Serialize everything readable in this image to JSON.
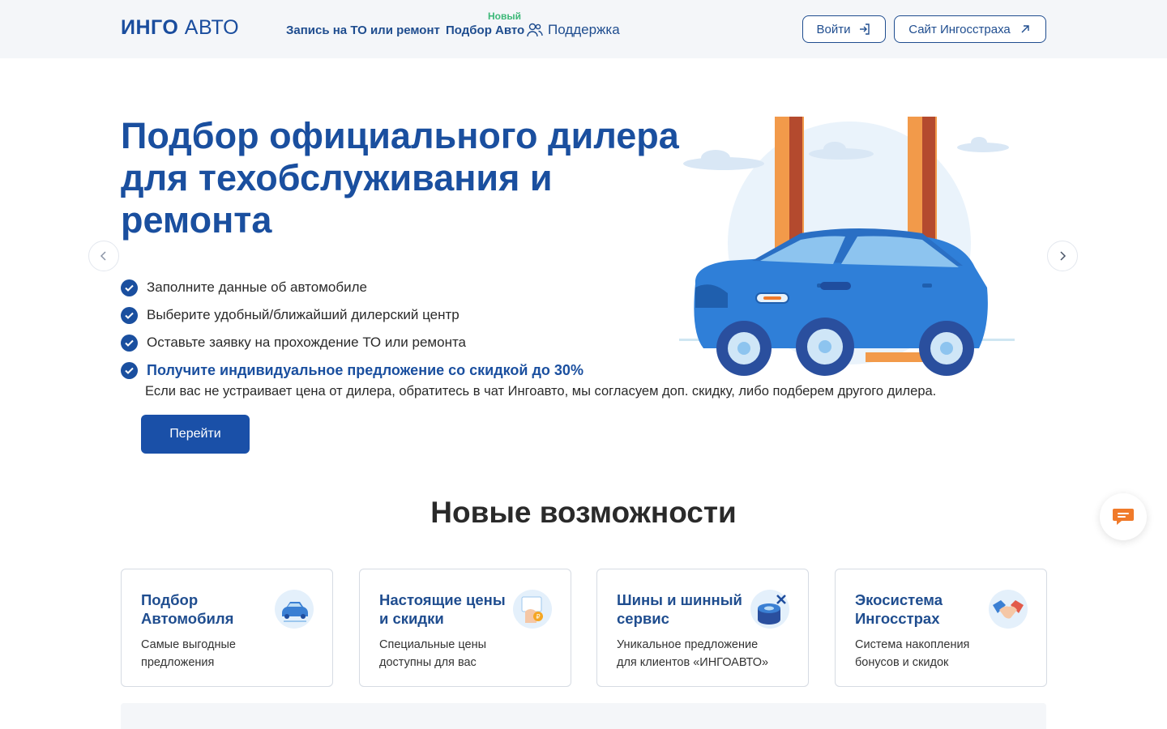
{
  "header": {
    "logo_bold": "ИНГО",
    "logo_light": "АВТО",
    "nav": [
      {
        "label": "Запись на ТО или ремонт"
      },
      {
        "label": "Подбор Авто",
        "badge": "Новый"
      },
      {
        "label": "Поддержка",
        "icon": "users-icon"
      }
    ],
    "login_label": "Войти",
    "site_label": "Сайт Ингосстраха"
  },
  "hero": {
    "title": "Подбор официального дилера для техобслуживания и ремонта",
    "features": [
      "Заполните данные об автомобиле",
      "Выберите удобный/ближайший дилерский центр",
      "Оставьте заявку на прохождение ТО или ремонта",
      "Получите индивидуальное предложение со скидкой до 30%"
    ],
    "note": "Если вас не устраивает цена от дилера, обратитесь в чат Ингоавто, мы согласуем доп. скидку, либо подберем другого дилера.",
    "cta_label": "Перейти"
  },
  "section": {
    "title": "Новые возможности",
    "cards": [
      {
        "title": "Подбор Автомобиля",
        "desc": "Самые выгодные предложения",
        "icon": "car-icon"
      },
      {
        "title": "Настоящие цены и скидки",
        "desc": "Специальные цены доступны для вас",
        "icon": "price-tag-icon"
      },
      {
        "title": "Шины и шинный сервис",
        "desc": "Уникальное предложение для клиентов «ИНГОАВТО»",
        "icon": "tires-icon"
      },
      {
        "title": "Экосистема Ингосстрах",
        "desc": "Система накопления бонусов и скидок",
        "icon": "handshake-icon"
      }
    ]
  },
  "colors": {
    "brand": "#1a4f9f",
    "badge": "#3cb878",
    "chat_accent": "#f07a2a"
  }
}
